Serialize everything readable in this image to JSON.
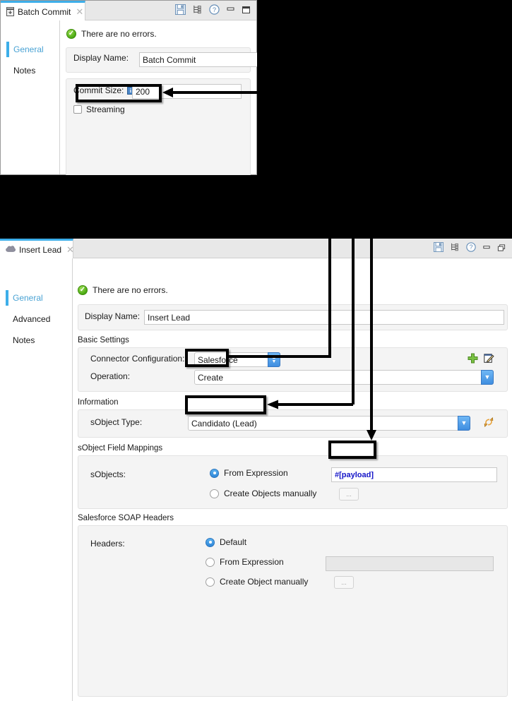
{
  "panel_batch": {
    "tab": {
      "label": "Batch Commit",
      "icon": "batch-commit-icon",
      "close": "✕"
    },
    "toolbar": [
      "save-icon",
      "tree-icon",
      "help-icon",
      "minimize-icon",
      "maximize-icon"
    ],
    "sidebar": [
      {
        "label": "General",
        "active": true
      },
      {
        "label": "Notes",
        "active": false
      }
    ],
    "status": "There are no errors.",
    "display_name_label": "Display Name:",
    "display_name_value": "Batch Commit",
    "commit_size_label": "Commit Size:",
    "commit_size_value": "200",
    "streaming_label": "Streaming",
    "streaming_checked": false
  },
  "panel_insert": {
    "tab": {
      "label": "Insert Lead",
      "icon": "salesforce-cloud-icon",
      "close": "✕"
    },
    "toolbar": [
      "save-icon",
      "tree-icon",
      "help-icon",
      "minimize-icon",
      "restore-icon"
    ],
    "sidebar": [
      {
        "label": "General",
        "active": true
      },
      {
        "label": "Advanced",
        "active": false
      },
      {
        "label": "Notes",
        "active": false
      }
    ],
    "status": "There are no errors.",
    "display_name_label": "Display Name:",
    "display_name_value": "Insert Lead",
    "basic_settings": {
      "title": "Basic Settings",
      "connector_label": "Connector Configuration:",
      "connector_value": "Salesforce",
      "add_icon": "plus-icon",
      "edit_icon": "edit-pencil-icon",
      "operation_label": "Operation:",
      "operation_value": "Create"
    },
    "information": {
      "title": "Information",
      "sobject_type_label": "sObject Type:",
      "sobject_type_value": "Candidato (Lead)",
      "refresh_icon": "refresh-metadata-icon"
    },
    "field_mappings": {
      "title": "sObject Field Mappings",
      "sobjects_label": "sObjects:",
      "option_expression": "From Expression",
      "option_manual": "Create Objects manually",
      "selected": "From Expression",
      "expression_value": "#[payload]",
      "expression_color": "#1414c8",
      "browse_label": "..."
    },
    "soap_headers": {
      "title": "Salesforce SOAP Headers",
      "headers_label": "Headers:",
      "option_default": "Default",
      "option_expression": "From Expression",
      "option_manual": "Create Object manually",
      "selected": "Default",
      "expression_value": "",
      "browse_label": "..."
    }
  },
  "annotations": {
    "accent": "#3daee9",
    "highlight_color": "#000000",
    "callouts": [
      "commit-size-highlight",
      "operation-create-highlight",
      "sobject-type-highlight",
      "payload-expression-highlight"
    ]
  }
}
